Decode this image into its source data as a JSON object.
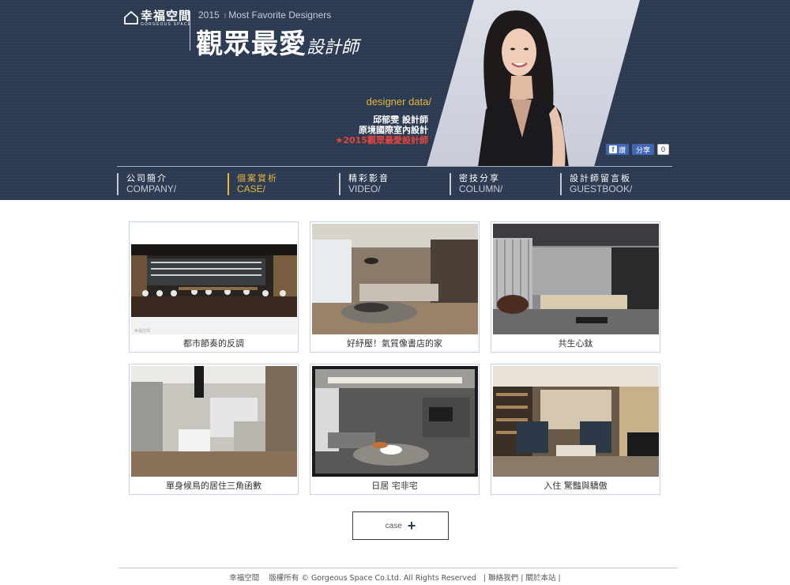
{
  "header": {
    "logo_cn": "幸福空間",
    "logo_en": "GORGEOUS SPACE",
    "year": "2015",
    "year_separator": "I",
    "tagline": "Most Favorite Designers",
    "title_main": "觀眾最愛",
    "title_sub": "設計師",
    "designer_data_label": "designer data/",
    "designer_name": "邱郁雯 設計師",
    "designer_company": "原境國際室內設計",
    "designer_award": "★2015觀眾最愛設計師",
    "share": {
      "fb_label": "讚",
      "share_label": "分享",
      "count": "0"
    }
  },
  "nav": [
    {
      "cn": "公司簡介",
      "en": "COMPANY/",
      "active": false
    },
    {
      "cn": "個案賞析",
      "en": "CASE/",
      "active": true
    },
    {
      "cn": "精彩影音",
      "en": "VIDEO/",
      "active": false
    },
    {
      "cn": "密技分享",
      "en": "COLUMN/",
      "active": false
    },
    {
      "cn": "設計師留言板",
      "en": "GUESTBOOK/",
      "active": false
    }
  ],
  "cases": [
    {
      "title": "都市節奏的反調"
    },
    {
      "title": "好紓壓！氣質像書店的家"
    },
    {
      "title": "共生心鈦"
    },
    {
      "title": "單身候鳥的居住三角函數"
    },
    {
      "title": "日居 宅非宅"
    },
    {
      "title": "入住 驚豔與驕傲"
    }
  ],
  "more_button": {
    "label": "case",
    "icon": "plus-icon"
  },
  "footer": {
    "site": "幸福空間",
    "copyright": "版權所有 © Gorgeous Space Co.Ltd. All Rights Reserved",
    "links": [
      "聯絡我們",
      "關於本站"
    ]
  },
  "colors": {
    "header_bg": "#2c3a52",
    "accent": "#e6b83a",
    "award": "#e8453c",
    "card_border": "#c4d2e4"
  }
}
